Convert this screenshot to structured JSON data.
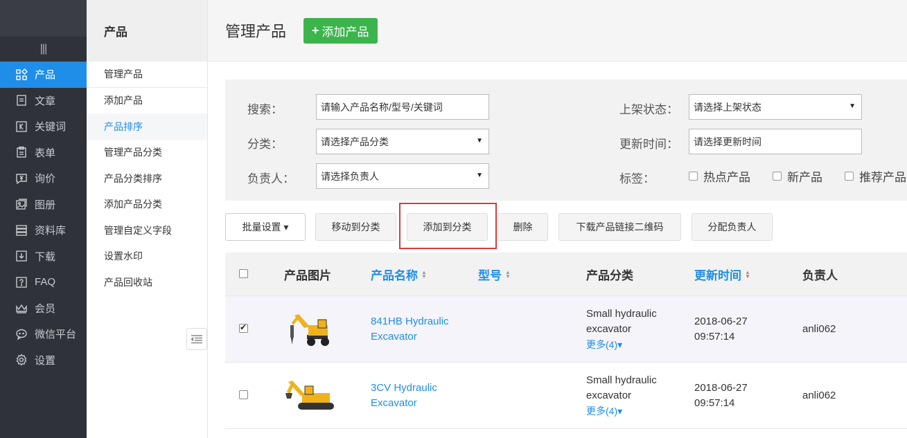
{
  "nav": {
    "toggle": "|||",
    "items": [
      {
        "label": "产品",
        "icon": "grid-icon"
      },
      {
        "label": "文章",
        "icon": "article-icon"
      },
      {
        "label": "关键词",
        "icon": "keyword-icon"
      },
      {
        "label": "表单",
        "icon": "form-icon"
      },
      {
        "label": "询价",
        "icon": "inquiry-icon"
      },
      {
        "label": "图册",
        "icon": "album-icon"
      },
      {
        "label": "资料库",
        "icon": "database-icon"
      },
      {
        "label": "下载",
        "icon": "download-icon"
      },
      {
        "label": "FAQ",
        "icon": "faq-icon"
      },
      {
        "label": "会员",
        "icon": "member-icon"
      },
      {
        "label": "微信平台",
        "icon": "wechat-icon"
      },
      {
        "label": "设置",
        "icon": "gear-icon"
      }
    ]
  },
  "submenu": {
    "title": "产品",
    "items": [
      "管理产品",
      "添加产品",
      "产品排序",
      "管理产品分类",
      "产品分类排序",
      "添加产品分类",
      "管理自定义字段",
      "设置水印",
      "产品回收站"
    ]
  },
  "header": {
    "title": "管理产品",
    "add_button": "添加产品",
    "add_symbol": "+"
  },
  "filter": {
    "search_label": "搜索：",
    "search_placeholder": "请输入产品名称/型号/关键词",
    "category_label": "分类：",
    "category_value": "请选择产品分类",
    "owner_label": "负责人：",
    "owner_value": "请选择负责人",
    "status_label": "上架状态：",
    "status_value": "请选择上架状态",
    "update_label": "更新时间：",
    "update_value": "请选择更新时间",
    "tag_label": "标签：",
    "tags": [
      "热点产品",
      "新产品",
      "推荐产品"
    ],
    "dropdown_arrow": "▼"
  },
  "actions": {
    "batch": "批量设置 ▾",
    "move": "移动到分类",
    "add_to_category": "添加到分类",
    "delete": "删除",
    "download_qr": "下载产品链接二维码",
    "assign": "分配负责人"
  },
  "table": {
    "headers": {
      "image": "产品图片",
      "name": "产品名称",
      "model": "型号",
      "category": "产品分类",
      "updated": "更新时间",
      "owner": "负责人"
    },
    "rows": [
      {
        "checked": true,
        "name_line1": "841HB Hydraulic",
        "name_line2": "Excavator",
        "category_line1": "Small hydraulic",
        "category_line2": "excavator",
        "more": "更多(4)▾",
        "date": "2018-06-27",
        "time": "09:57:14",
        "owner": "anli062"
      },
      {
        "checked": false,
        "name_line1": "3CV Hydraulic",
        "name_line2": "Excavator",
        "category_line1": "Small hydraulic",
        "category_line2": "excavator",
        "more": "更多(4)▾",
        "date": "2018-06-27",
        "time": "09:57:14",
        "owner": "anli062"
      }
    ]
  },
  "colors": {
    "nav_bg": "#2f3239",
    "accent_blue": "#1e8ee8",
    "add_green": "#3cb44c",
    "highlight_red": "#d83a3a",
    "excavator_yellow": "#f0b21c"
  }
}
